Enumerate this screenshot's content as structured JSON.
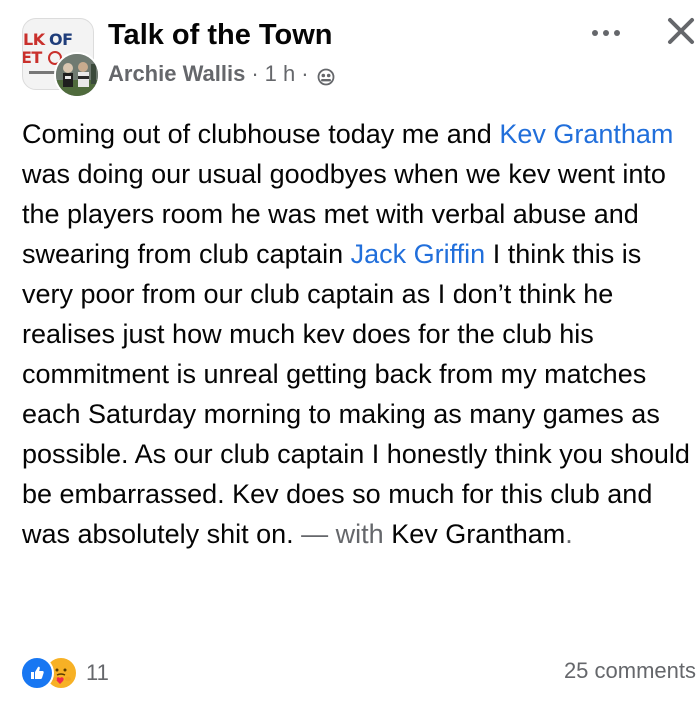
{
  "header": {
    "group_name": "Talk of the Town",
    "group_logo_text": "LK OF\nET O",
    "author": "Archie Wallis",
    "separator": "·",
    "time": "1 h",
    "audience_icon": "globe-icon",
    "more_icon": "more-icon",
    "close_icon": "close-icon"
  },
  "post": {
    "segments": [
      {
        "text": "Coming out of clubhouse today me and ",
        "type": "text"
      },
      {
        "text": "Kev Grantham",
        "type": "mention"
      },
      {
        "text": " was doing our usual goodbyes when we kev went into the players room he was met with verbal abuse and swearing from club captain ",
        "type": "text"
      },
      {
        "text": "Jack Griffin",
        "type": "mention"
      },
      {
        "text": " I think this is very poor from our club captain as I don’t think he realises just how much kev does for the club his commitment is unreal getting back from my matches each Saturday morning to making as many games as possible. As our club captain I honestly think you should be embarrassed. Kev does so much for this club and was absolutely shit on. ",
        "type": "text"
      },
      {
        "text": "— with ",
        "type": "with"
      },
      {
        "text": "Kev Grantham",
        "type": "tagged"
      },
      {
        "text": ".",
        "type": "end"
      }
    ]
  },
  "footer": {
    "reaction_icons": [
      "like-icon",
      "care-icon"
    ],
    "reaction_count": "11",
    "comments": "25 comments"
  },
  "colors": {
    "mention": "#216fdb",
    "secondary_text": "#65676b",
    "like": "#1877f2",
    "care": "#f7b125"
  }
}
